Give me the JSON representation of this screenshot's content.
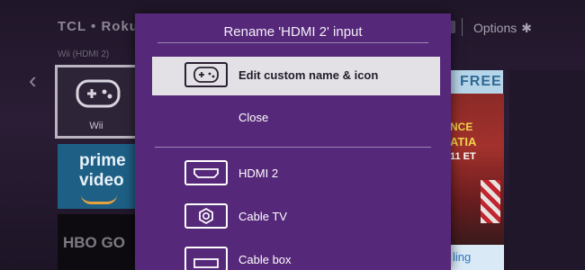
{
  "background": {
    "brand": "TCL • Roku",
    "options_label": "Options",
    "options_symbol": "✱",
    "input_label": "Wii (HDMI 2)",
    "tiles": {
      "wii_label": "Wii",
      "prime_line1": "prime",
      "prime_line2": "video",
      "hbo_text": "HBO GO",
      "free_text": "FREE",
      "sport_line1": "NCE",
      "sport_line2": "ATIA",
      "sport_line3": "11 ET",
      "sling_text": "ling"
    }
  },
  "dialog": {
    "title": "Rename 'HDMI 2' input",
    "items": [
      {
        "label": "Edit custom name & icon",
        "icon": "gamepad-icon",
        "selected": true
      },
      {
        "label": "Close"
      },
      {
        "label": "HDMI 2",
        "icon": "hdmi-icon"
      },
      {
        "label": "Cable TV",
        "icon": "coax-icon"
      },
      {
        "label": "Cable box",
        "icon": "cable-box-icon"
      }
    ]
  },
  "colors": {
    "dialog_bg": "#56287a",
    "selected_bg": "#e3e1e6",
    "home_bg": "#201629"
  }
}
